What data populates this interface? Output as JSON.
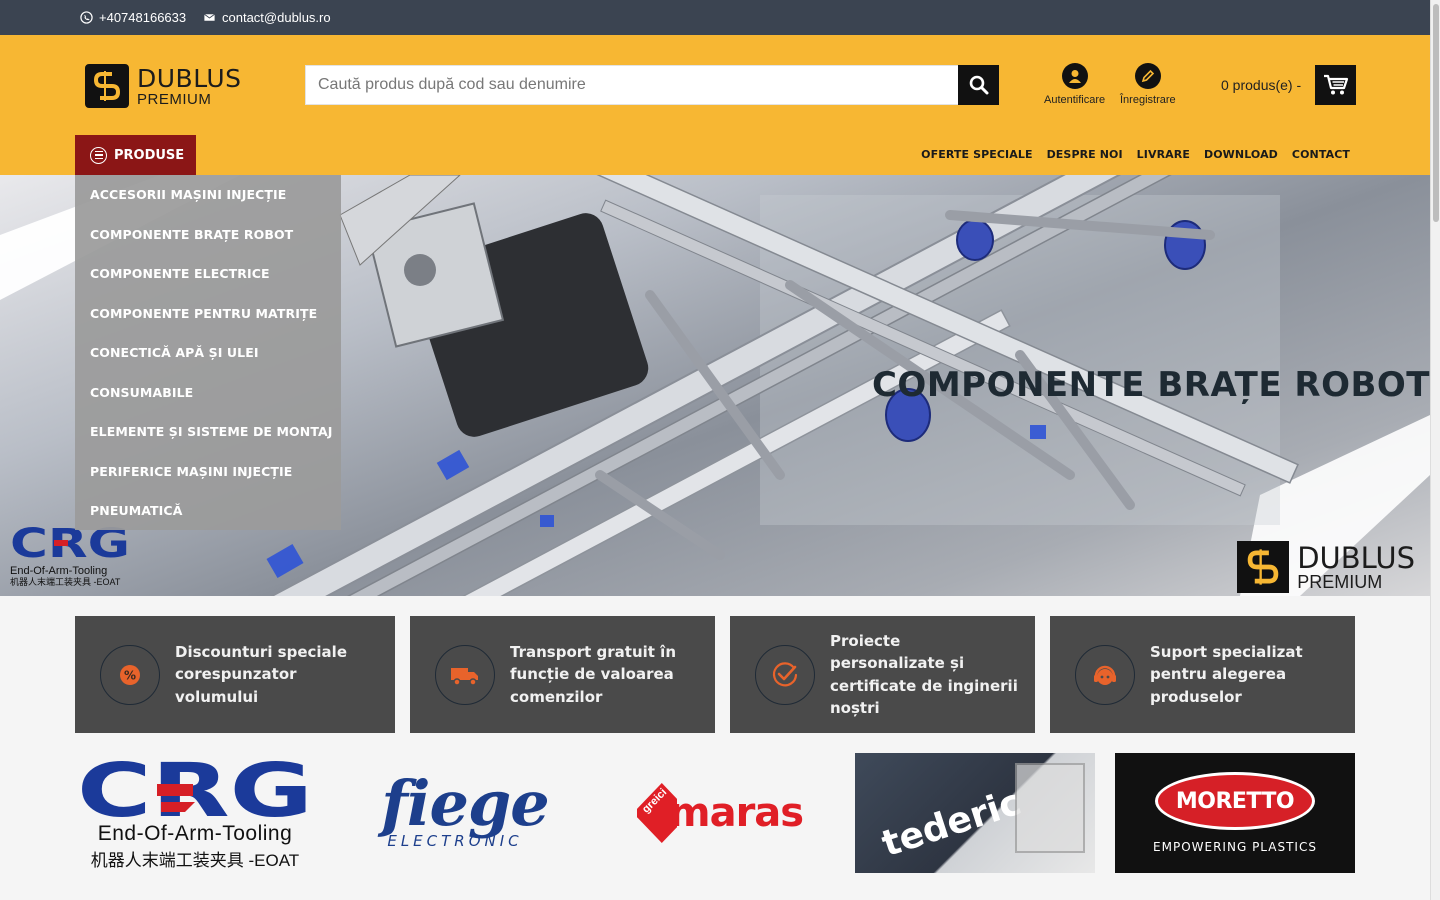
{
  "topbar": {
    "phone": "+40748166633",
    "email": "contact@dublus.ro"
  },
  "logo": {
    "line1": "DUBLUS",
    "line2": "PREMIUM"
  },
  "search": {
    "placeholder": "Caută produs după cod sau denumire",
    "button_icon": "search-icon"
  },
  "account": {
    "login_label": "Autentificare",
    "register_label": "Înregistrare"
  },
  "cart": {
    "label": "0 produs(e) -",
    "icon": "cart-icon"
  },
  "products_button": "PRODUSE",
  "nav": [
    "OFERTE SPECIALE",
    "DESPRE NOI",
    "LIVRARE",
    "DOWNLOAD",
    "CONTACT"
  ],
  "dropdown": [
    "ACCESORII MAȘINI INJECȚIE",
    "COMPONENTE BRAȚE ROBOT",
    "COMPONENTE ELECTRICE",
    "COMPONENTE PENTRU MATRIȚE",
    "CONECTICĂ APĂ ȘI ULEI",
    "CONSUMABILE",
    "ELEMENTE ȘI SISTEME DE MONTAJ",
    "PERIFERICE MAȘINI INJECȚIE",
    "PNEUMATICĂ"
  ],
  "hero": {
    "title": "COMPONENTE BRAȚE ROBOT",
    "brand_line1": "DUBLUS",
    "brand_line2": "PREMIUM",
    "crg_line1": "End-Of-Arm-Tooling",
    "crg_line2": "机器人末端工装夹具 -EOAT"
  },
  "features": [
    {
      "text": "Discounturi speciale corespunzator volumului",
      "icon": "percent-icon"
    },
    {
      "text": "Transport gratuit în funcție de valoarea comenzilor",
      "icon": "truck-icon"
    },
    {
      "text": "Proiecte personalizate și certificate de inginerii noștri",
      "icon": "check-icon"
    },
    {
      "text": "Suport specializat pentru alegerea produselor",
      "icon": "headset-icon"
    }
  ],
  "brands": {
    "crg": {
      "line1": "End-Of-Arm-Tooling",
      "line2": "机器人末端工装夹具 -EOAT"
    },
    "fiege": {
      "line1": "fiege",
      "line2": "ELECTRONIC"
    },
    "maras": {
      "tag": "greici",
      "name": "maras"
    },
    "tederic": {
      "name": "tederic"
    },
    "moretto": {
      "name": "MORETTO",
      "tagline": "EMPOWERING PLASTICS"
    }
  },
  "colors": {
    "topbar": "#3b4451",
    "header": "#f7b733",
    "products_button": "#8b1616",
    "feature_bg": "#4a4a4a",
    "accent_orange": "#e8632b"
  }
}
